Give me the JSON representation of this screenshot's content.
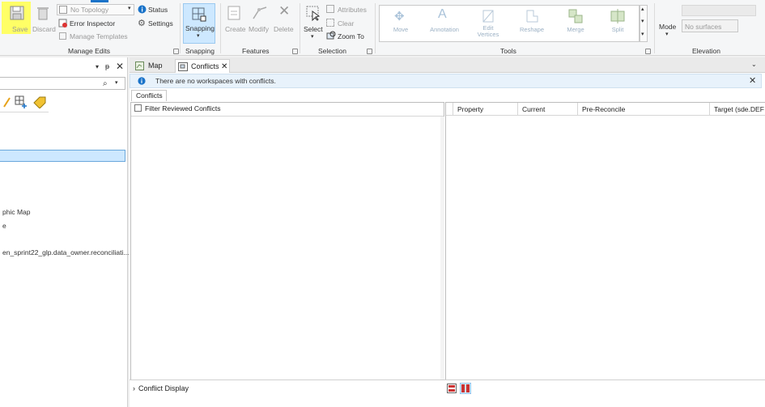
{
  "ribbon": {
    "manage_edits": {
      "save": "Save",
      "discard": "Discard",
      "topology_value": "No Topology",
      "error_inspector": "Error Inspector",
      "manage_templates": "Manage Templates",
      "status": "Status",
      "settings": "Settings",
      "group_label": "Manage Edits"
    },
    "snapping": {
      "button": "Snapping",
      "group_label": "Snapping"
    },
    "features": {
      "create": "Create",
      "modify": "Modify",
      "delete": "Delete",
      "group_label": "Features"
    },
    "selection": {
      "select": "Select",
      "attributes": "Attributes",
      "clear": "Clear",
      "zoom_to": "Zoom To",
      "group_label": "Selection"
    },
    "tools": {
      "items": [
        "Move",
        "Annotation",
        "Edit Vertices",
        "Reshape",
        "Merge",
        "Split"
      ],
      "group_label": "Tools"
    },
    "elevation": {
      "mode": "Mode",
      "surface_value": "No surfaces",
      "group_label": "Elevation"
    }
  },
  "left_pane": {
    "items": [
      "phic Map",
      "e",
      "en_sprint22_glp.data_owner.reconciliati..."
    ]
  },
  "tabs": [
    {
      "label": "Map"
    },
    {
      "label": "Conflicts"
    }
  ],
  "info_message": "There are no workspaces with conflicts.",
  "conflicts_tab": "Conflicts",
  "filter_reviewed": "Filter Reviewed Conflicts",
  "grid_columns": [
    "Property",
    "Current",
    "Pre-Reconcile",
    "Target (sde.DEF"
  ],
  "conflict_display": "Conflict Display",
  "colors": {
    "highlight": "#ffff66",
    "accent": "#1a73c9",
    "snapping_bg": "#cde8ff"
  }
}
